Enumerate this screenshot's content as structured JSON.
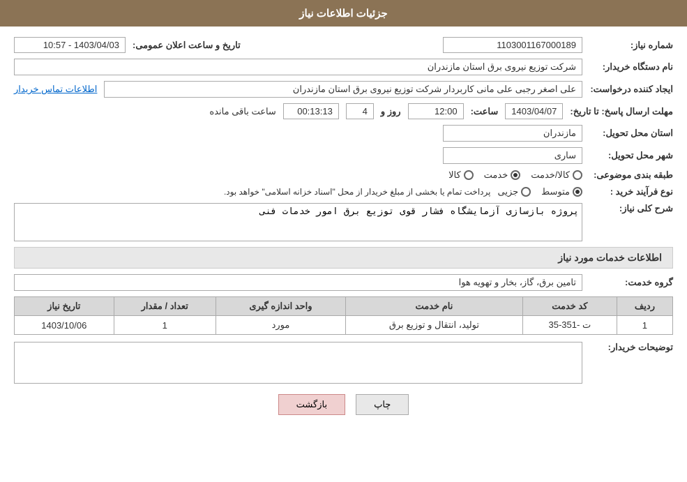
{
  "header": {
    "title": "جزئیات اطلاعات نیاز"
  },
  "fields": {
    "shomara_niaz_label": "شماره نیاز:",
    "shomara_niaz_value": "1103001167000189",
    "nam_dastgah_label": "نام دستگاه خریدار:",
    "nam_dastgah_value": "شرکت توزیع نیروی برق استان مازندران",
    "ijad_konande_label": "ایجاد کننده درخواست:",
    "ijad_konande_value": "علی اصغر رجبی علی مانی کاربردار شرکت توزیع نیروی برق استان مازندران",
    "ettelaat_link": "اطلاعات تماس خریدار",
    "mohlet_label": "مهلت ارسال پاسخ: تا تاریخ:",
    "tarikh_value": "1403/04/07",
    "saat_label": "ساعت:",
    "saat_value": "12:00",
    "rooz_label": "روز و",
    "rooz_value": "4",
    "saat_baqi_label": "ساعت باقی مانده",
    "saat_baqi_value": "00:13:13",
    "tarikh_aalan_label": "تاریخ و ساعت اعلان عمومی:",
    "tarikh_aalan_value": "1403/04/03 - 10:57",
    "ostan_label": "استان محل تحویل:",
    "ostan_value": "مازندران",
    "shahr_label": "شهر محل تحویل:",
    "shahr_value": "ساری",
    "tabaqe_label": "طبقه بندی موضوعی:",
    "tabaqe_kala": "کالا",
    "tabaqe_khedmat": "خدمت",
    "tabaqe_kala_khedmat": "کالا/خدمت",
    "tabaqe_selected": "khedmat",
    "nooe_farayand_label": "نوع فرآیند خرید :",
    "nooe_jozei": "جزیی",
    "nooe_motavaset": "متوسط",
    "nooe_text": "پرداخت تمام یا بخشی از مبلغ خریدار از محل \"اسناد خزانه اسلامی\" خواهد بود.",
    "sharh_label": "شرح کلی نیاز:",
    "sharh_value": "پروژه بازسازی آزمایشگاه فشار قوی توزیع برق امور خدمات فنی",
    "ettelaat_khedmat_title": "اطلاعات خدمات مورد نیاز",
    "gorooh_label": "گروه خدمت:",
    "gorooh_value": "تامین برق، گاز، بخار و تهویه هوا",
    "table": {
      "headers": [
        "ردیف",
        "کد خدمت",
        "نام خدمت",
        "واحد اندازه گیری",
        "تعداد / مقدار",
        "تاریخ نیاز"
      ],
      "rows": [
        {
          "radif": "1",
          "kod": "ت -351-35",
          "nam": "تولید، انتقال و توزیع برق",
          "vahed": "مورد",
          "tedad": "1",
          "tarikh": "1403/10/06"
        }
      ]
    },
    "tozihat_label": "توضیحات خریدار:",
    "tozihat_value": ""
  },
  "buttons": {
    "print": "چاپ",
    "back": "بازگشت"
  }
}
